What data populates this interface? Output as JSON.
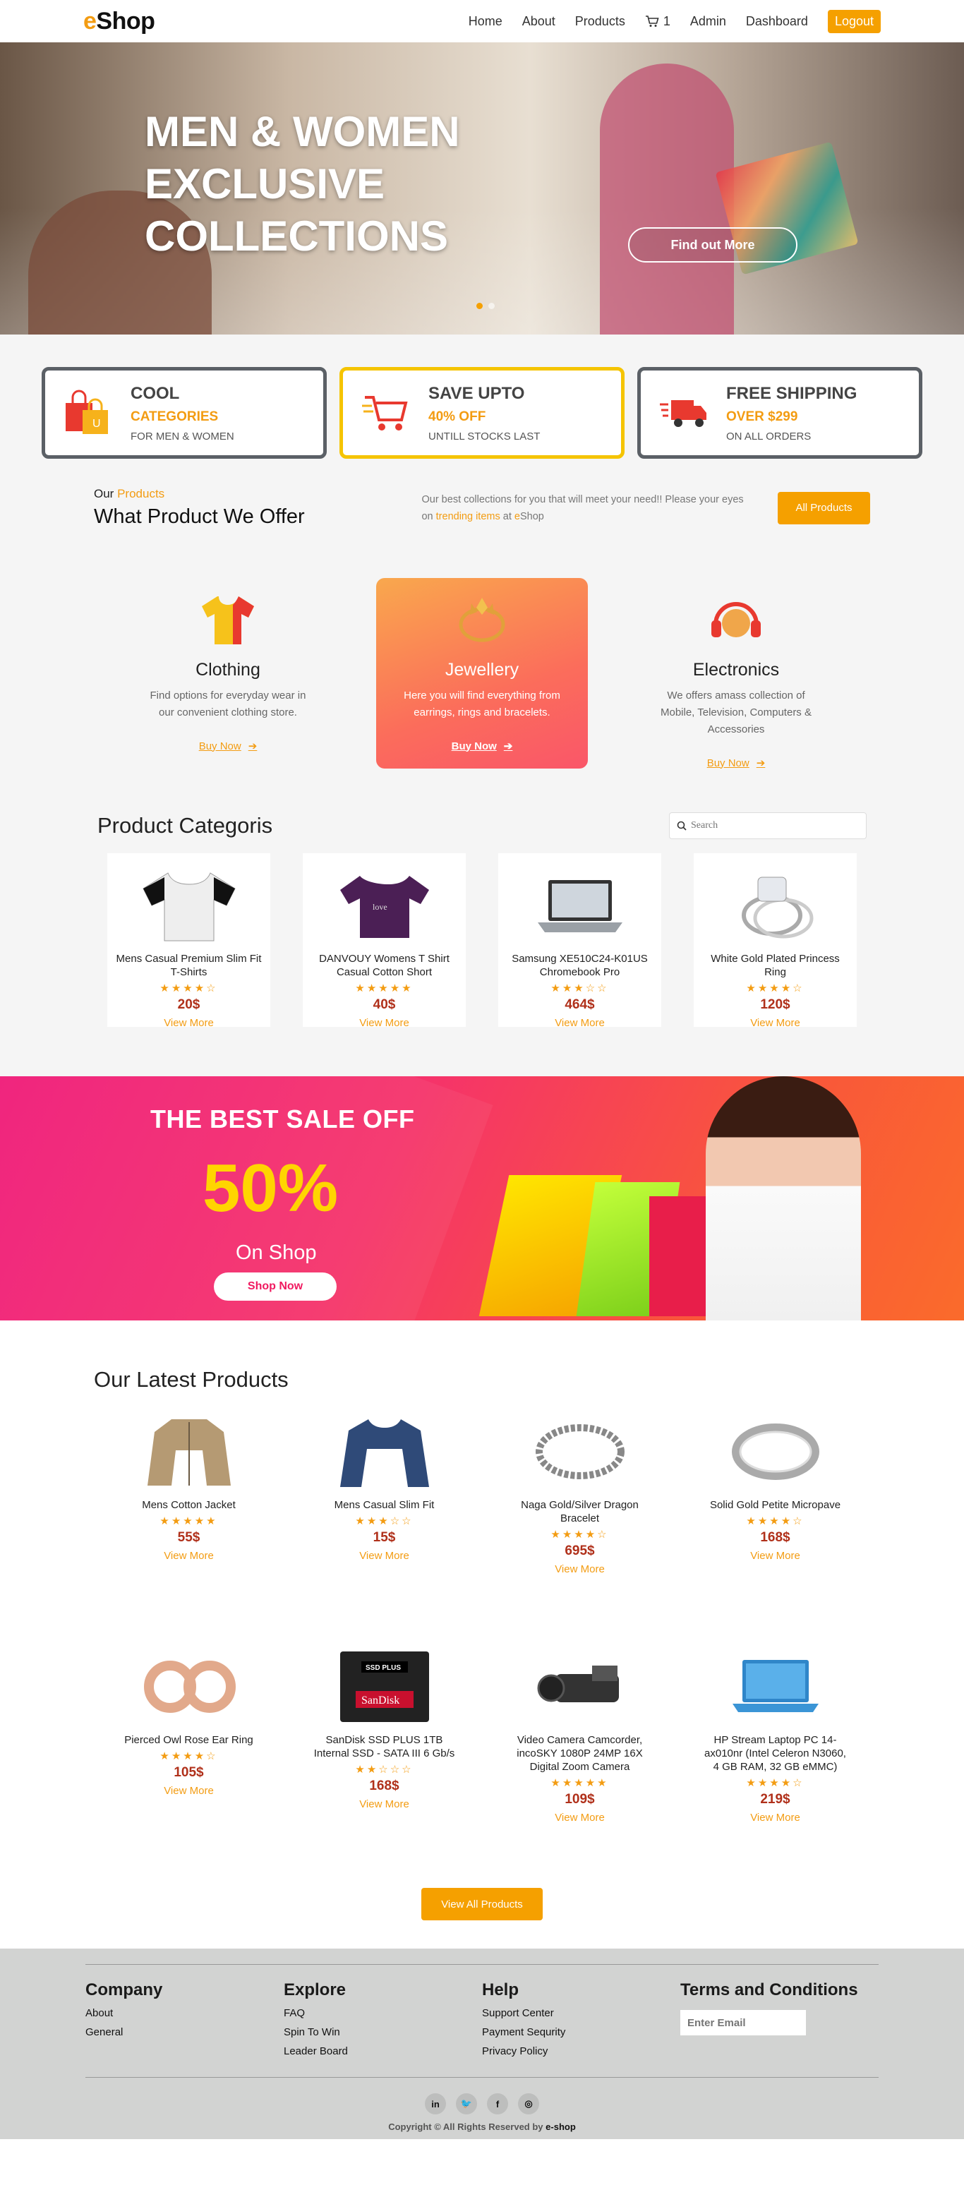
{
  "nav": {
    "logo_e": "e",
    "logo_rest": "Shop",
    "items": [
      "Home",
      "About",
      "Products"
    ],
    "cart_count": "1",
    "admin": "Admin",
    "dashboard": "Dashboard",
    "logout": "Logout"
  },
  "hero": {
    "line1": "MEN & WOMEN",
    "line2": "EXCLUSIVE",
    "line3": "COLLECTIONS",
    "button": "Find out More"
  },
  "features": [
    {
      "title": "COOL",
      "highlight": "CATEGORIES",
      "sub": "FOR MEN & WOMEN",
      "icon": "shopping-bags-icon"
    },
    {
      "title": "SAVE UPTO",
      "highlight": "40% OFF",
      "sub": "UNTILL STOCKS LAST",
      "icon": "cart-icon"
    },
    {
      "title": "FREE SHIPPING",
      "highlight": "OVER $299",
      "sub": "ON ALL ORDERS",
      "icon": "truck-icon"
    }
  ],
  "offer": {
    "small_prefix": "Our",
    "small_highlight": "Products",
    "title": "What Product We Offer",
    "desc_1": "Our best collections for you that will meet your need!! Please your eyes on",
    "desc_link": "trending items",
    "desc_2": "at",
    "desc_brand_e": "e",
    "desc_brand_rest": "Shop",
    "button": "All Products"
  },
  "categories": [
    {
      "title": "Clothing",
      "desc": "Find options for everyday wear in our convenient clothing store.",
      "buy": "Buy Now"
    },
    {
      "title": "Jewellery",
      "desc": "Here you will find everything from earrings, rings and bracelets.",
      "buy": "Buy Now"
    },
    {
      "title": "Electronics",
      "desc": "We offers amass collection of Mobile, Television, Computers & Accessories",
      "buy": "Buy Now"
    }
  ],
  "product_categories": {
    "title": "Product Categoris",
    "search_placeholder": "Search",
    "items": [
      {
        "name": "Mens Casual Premium Slim Fit T-Shirts",
        "stars": "★★★★☆",
        "price": "20$",
        "link": "View More"
      },
      {
        "name": "DANVOUY Womens T Shirt Casual Cotton Short",
        "stars": "★★★★★",
        "price": "40$",
        "link": "View More"
      },
      {
        "name": "Samsung XE510C24-K01US Chromebook Pro",
        "stars": "★★★☆☆",
        "price": "464$",
        "link": "View More"
      },
      {
        "name": "White Gold Plated Princess Ring",
        "stars": "★★★★☆",
        "price": "120$",
        "link": "View More"
      }
    ]
  },
  "sale": {
    "title": "THE BEST SALE OFF",
    "percent": "50%",
    "sub": "On Shop",
    "button": "Shop Now"
  },
  "latest": {
    "title": "Our Latest Products",
    "items": [
      {
        "name": "Mens Cotton Jacket",
        "stars": "★★★★★",
        "price": "55$",
        "link": "View More"
      },
      {
        "name": "Mens Casual Slim Fit",
        "stars": "★★★☆☆",
        "price": "15$",
        "link": "View More"
      },
      {
        "name": "Naga Gold/Silver Dragon Bracelet",
        "stars": "★★★★☆",
        "price": "695$",
        "link": "View More"
      },
      {
        "name": "Solid Gold Petite Micropave",
        "stars": "★★★★☆",
        "price": "168$",
        "link": "View More"
      },
      {
        "name": "Pierced Owl Rose Ear Ring",
        "stars": "★★★★☆",
        "price": "105$",
        "link": "View More"
      },
      {
        "name": "SanDisk SSD PLUS 1TB Internal SSD - SATA III 6 Gb/s",
        "stars": "★★☆☆☆",
        "price": "168$",
        "link": "View More"
      },
      {
        "name": "Video Camera Camcorder, incoSKY 1080P 24MP 16X Digital Zoom Camera",
        "stars": "★★★★★",
        "price": "109$",
        "link": "View More"
      },
      {
        "name": "HP Stream Laptop PC 14-ax010nr (Intel Celeron N3060, 4 GB RAM, 32 GB eMMC)",
        "stars": "★★★★☆",
        "price": "219$",
        "link": "View More"
      }
    ],
    "button": "View All Products"
  },
  "footer": {
    "cols": [
      {
        "title": "Company",
        "links": [
          "About",
          "General"
        ]
      },
      {
        "title": "Explore",
        "links": [
          "FAQ",
          "Spin To Win",
          "Leader Board"
        ]
      },
      {
        "title": "Help",
        "links": [
          "Support Center",
          "Payment Sequrity",
          "Privacy Policy"
        ]
      }
    ],
    "terms_title": "Terms and Conditions",
    "email_placeholder": "Enter Email",
    "social": [
      "in",
      "🐦",
      "f",
      "◎"
    ],
    "copyright": "Copyright © All Rights Reserved by",
    "brand": "e-shop"
  },
  "colors": {
    "accent": "#f5a000",
    "price": "#b0301a",
    "sale_pink": "#f01a78",
    "footer": "#d2d3d2"
  }
}
